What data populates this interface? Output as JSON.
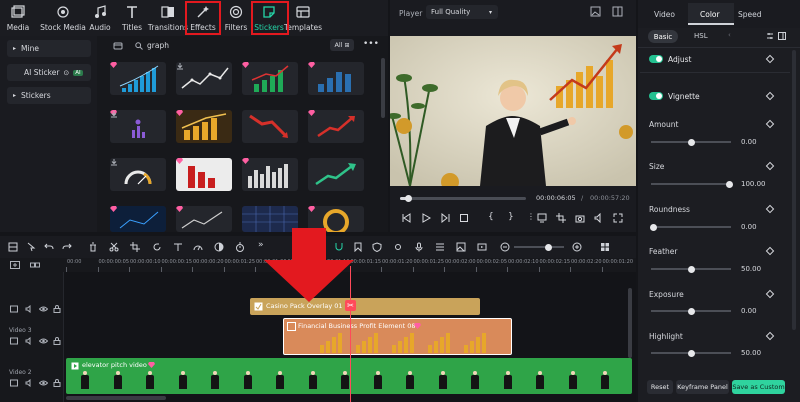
{
  "toolbar": {
    "items": [
      {
        "label": "Media",
        "icon": "media-icon"
      },
      {
        "label": "Stock Media",
        "icon": "stock-media-icon"
      },
      {
        "label": "Audio",
        "icon": "music-note-icon"
      },
      {
        "label": "Titles",
        "icon": "titles-icon"
      },
      {
        "label": "Transitions",
        "icon": "transitions-icon"
      },
      {
        "label": "Effects",
        "icon": "effects-icon"
      },
      {
        "label": "Filters",
        "icon": "filters-icon"
      },
      {
        "label": "Stickers",
        "icon": "stickers-icon"
      },
      {
        "label": "Templates",
        "icon": "templates-icon"
      }
    ],
    "highlighted": [
      "Effects",
      "Stickers"
    ],
    "highlight_color": "#e3191f",
    "active_color": "#25d6a8"
  },
  "sidebar": {
    "items": [
      {
        "label": "Mine"
      },
      {
        "label": "AI Sticker",
        "badge": "AI"
      },
      {
        "label": "Stickers"
      }
    ]
  },
  "search": {
    "value": "graph",
    "filter_label": "All"
  },
  "player": {
    "label": "Player",
    "quality": "Full Quality",
    "current_time": "00:00:06:05",
    "separator": "/",
    "total_time": "00:00:57:20",
    "progress": 0.07
  },
  "right_panel": {
    "tabs": [
      "Video",
      "Color",
      "Speed"
    ],
    "active_tab": "Color",
    "subtabs": [
      "Basic",
      "HSL"
    ],
    "active_subtab": "Basic",
    "sections": [
      {
        "label": "Adjust",
        "enabled": true
      },
      {
        "label": "Vignette",
        "enabled": true
      }
    ],
    "params": [
      {
        "label": "Amount",
        "value": "0.00",
        "level": 0.5
      },
      {
        "label": "Size",
        "value": "100.00",
        "level": 1.0
      },
      {
        "label": "Roundness",
        "value": "0.00",
        "level": 0.0
      },
      {
        "label": "Feather",
        "value": "50.00",
        "level": 0.5
      },
      {
        "label": "Exposure",
        "value": "0.00",
        "level": 0.5
      },
      {
        "label": "Highlight",
        "value": "50.00",
        "level": 0.5
      }
    ],
    "buttons": {
      "reset": "Reset",
      "keyframe": "Keyframe Panel",
      "save": "Save as Custom"
    },
    "save_color": "#2fd39e"
  },
  "timeline": {
    "ruler": [
      "00:00",
      "00:00:00:05",
      "00:00:00:10",
      "00:00:00:15",
      "00:00:00:20",
      "00:00:01:25",
      "00:00:01:00",
      "00:00:01:05",
      "00:00:01:10",
      "00:00:01:15",
      "00:00:01:20",
      "00:00:01:25",
      "00:00:02:00",
      "00:00:02:05",
      "00:00:02:10",
      "00:00:02:15",
      "00:00:02:20",
      "00:00:01:20"
    ],
    "tracks": [
      {
        "name": ""
      },
      {
        "name": "Video 3"
      },
      {
        "name": "Video 2"
      }
    ],
    "clips": {
      "overlay": "Casino Pack Overlay 01",
      "sticker": "Financial Business Profit Element 08",
      "video": "elevator pitch video"
    },
    "playhead_color": "#ff4a5a"
  },
  "annotation": {
    "type": "arrow-down",
    "color": "#e3191f"
  }
}
